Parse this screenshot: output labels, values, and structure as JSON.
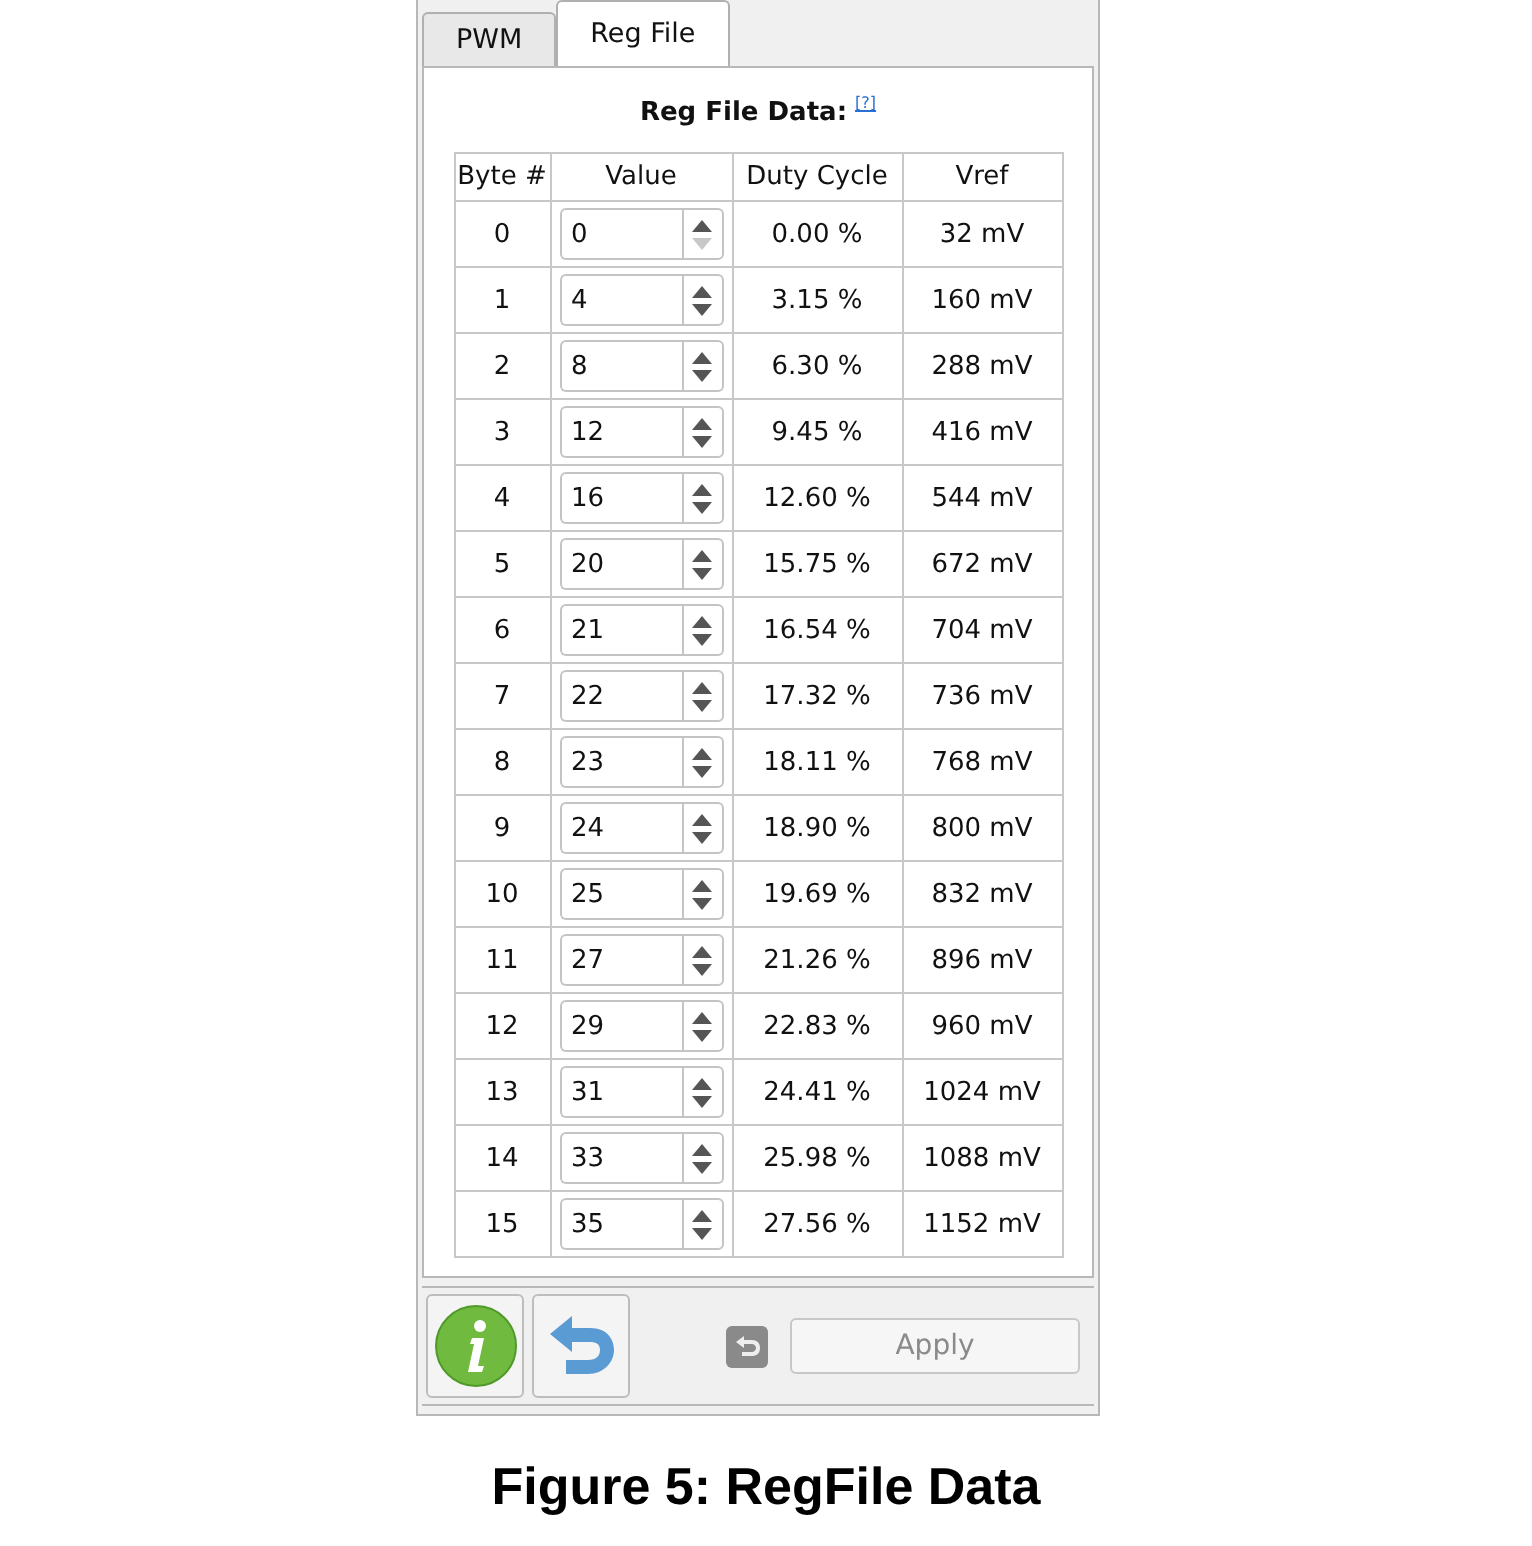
{
  "tabs": [
    {
      "label": "PWM",
      "selected": false
    },
    {
      "label": "Reg File",
      "selected": true
    }
  ],
  "section": {
    "title": "Reg File Data:",
    "help_link": "[?]"
  },
  "table": {
    "columns": [
      "Byte #",
      "Value",
      "Duty Cycle",
      "Vref"
    ],
    "rows": [
      {
        "byte": "0",
        "value": "0",
        "down_disabled": true,
        "duty": "0.00 %",
        "vref": "32 mV"
      },
      {
        "byte": "1",
        "value": "4",
        "down_disabled": false,
        "duty": "3.15 %",
        "vref": "160 mV"
      },
      {
        "byte": "2",
        "value": "8",
        "down_disabled": false,
        "duty": "6.30 %",
        "vref": "288 mV"
      },
      {
        "byte": "3",
        "value": "12",
        "down_disabled": false,
        "duty": "9.45 %",
        "vref": "416 mV"
      },
      {
        "byte": "4",
        "value": "16",
        "down_disabled": false,
        "duty": "12.60 %",
        "vref": "544 mV"
      },
      {
        "byte": "5",
        "value": "20",
        "down_disabled": false,
        "duty": "15.75 %",
        "vref": "672 mV"
      },
      {
        "byte": "6",
        "value": "21",
        "down_disabled": false,
        "duty": "16.54 %",
        "vref": "704 mV"
      },
      {
        "byte": "7",
        "value": "22",
        "down_disabled": false,
        "duty": "17.32 %",
        "vref": "736 mV"
      },
      {
        "byte": "8",
        "value": "23",
        "down_disabled": false,
        "duty": "18.11 %",
        "vref": "768 mV"
      },
      {
        "byte": "9",
        "value": "24",
        "down_disabled": false,
        "duty": "18.90 %",
        "vref": "800 mV"
      },
      {
        "byte": "10",
        "value": "25",
        "down_disabled": false,
        "duty": "19.69 %",
        "vref": "832 mV"
      },
      {
        "byte": "11",
        "value": "27",
        "down_disabled": false,
        "duty": "21.26 %",
        "vref": "896 mV"
      },
      {
        "byte": "12",
        "value": "29",
        "down_disabled": false,
        "duty": "22.83 %",
        "vref": "960 mV"
      },
      {
        "byte": "13",
        "value": "31",
        "down_disabled": false,
        "duty": "24.41 %",
        "vref": "1024 mV"
      },
      {
        "byte": "14",
        "value": "33",
        "down_disabled": false,
        "duty": "25.98 %",
        "vref": "1088 mV"
      },
      {
        "byte": "15",
        "value": "35",
        "down_disabled": false,
        "duty": "27.56 %",
        "vref": "1152 mV"
      }
    ]
  },
  "toolbar": {
    "apply_button": {
      "label": "Apply",
      "disabled": true
    }
  },
  "caption": "Figure 5: RegFile Data"
}
